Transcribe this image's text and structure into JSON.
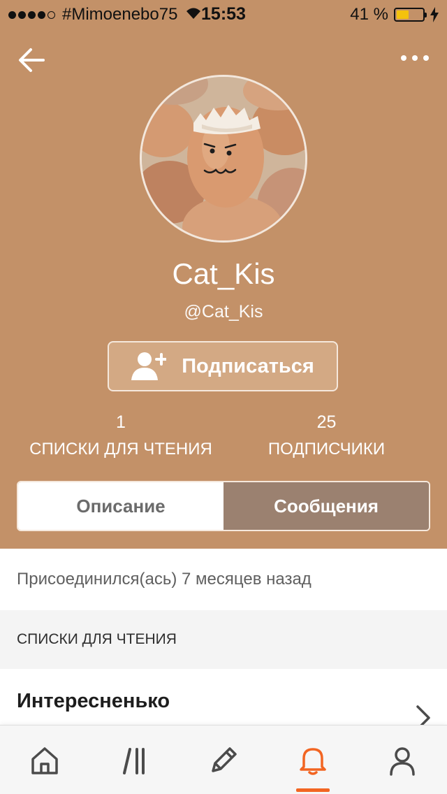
{
  "status_bar": {
    "carrier": "#Mimoenebo75",
    "time": "15:53",
    "battery": "41 %",
    "battery_level": 0.41
  },
  "profile": {
    "display_name": "Cat_Kis",
    "handle": "@Cat_Kis",
    "follow_label": "Подписаться"
  },
  "stats": {
    "reading_lists_count": "1",
    "reading_lists_label": "СПИСКИ ДЛЯ ЧТЕНИЯ",
    "followers_count": "25",
    "followers_label": "ПОДПИСЧИКИ"
  },
  "tabs": [
    {
      "label": "Описание",
      "active": true
    },
    {
      "label": "Сообщения",
      "active": false
    }
  ],
  "joined_text": "Присоединился(ась) 7 месяцев назад",
  "reading_lists": {
    "section_title": "СПИСКИ ДЛЯ ЧТЕНИЯ",
    "items": [
      {
        "title": "Интересненько",
        "subtitle": ""
      }
    ]
  },
  "bottom_nav": [
    {
      "icon": "home-icon",
      "active": false
    },
    {
      "icon": "library-icon",
      "active": false
    },
    {
      "icon": "pencil-icon",
      "active": false
    },
    {
      "icon": "bell-icon",
      "active": true
    },
    {
      "icon": "profile-icon",
      "active": false
    }
  ],
  "colors": {
    "header_bg": "#c39168",
    "inactive_tab": "#9b8170",
    "accent": "#f26522"
  }
}
